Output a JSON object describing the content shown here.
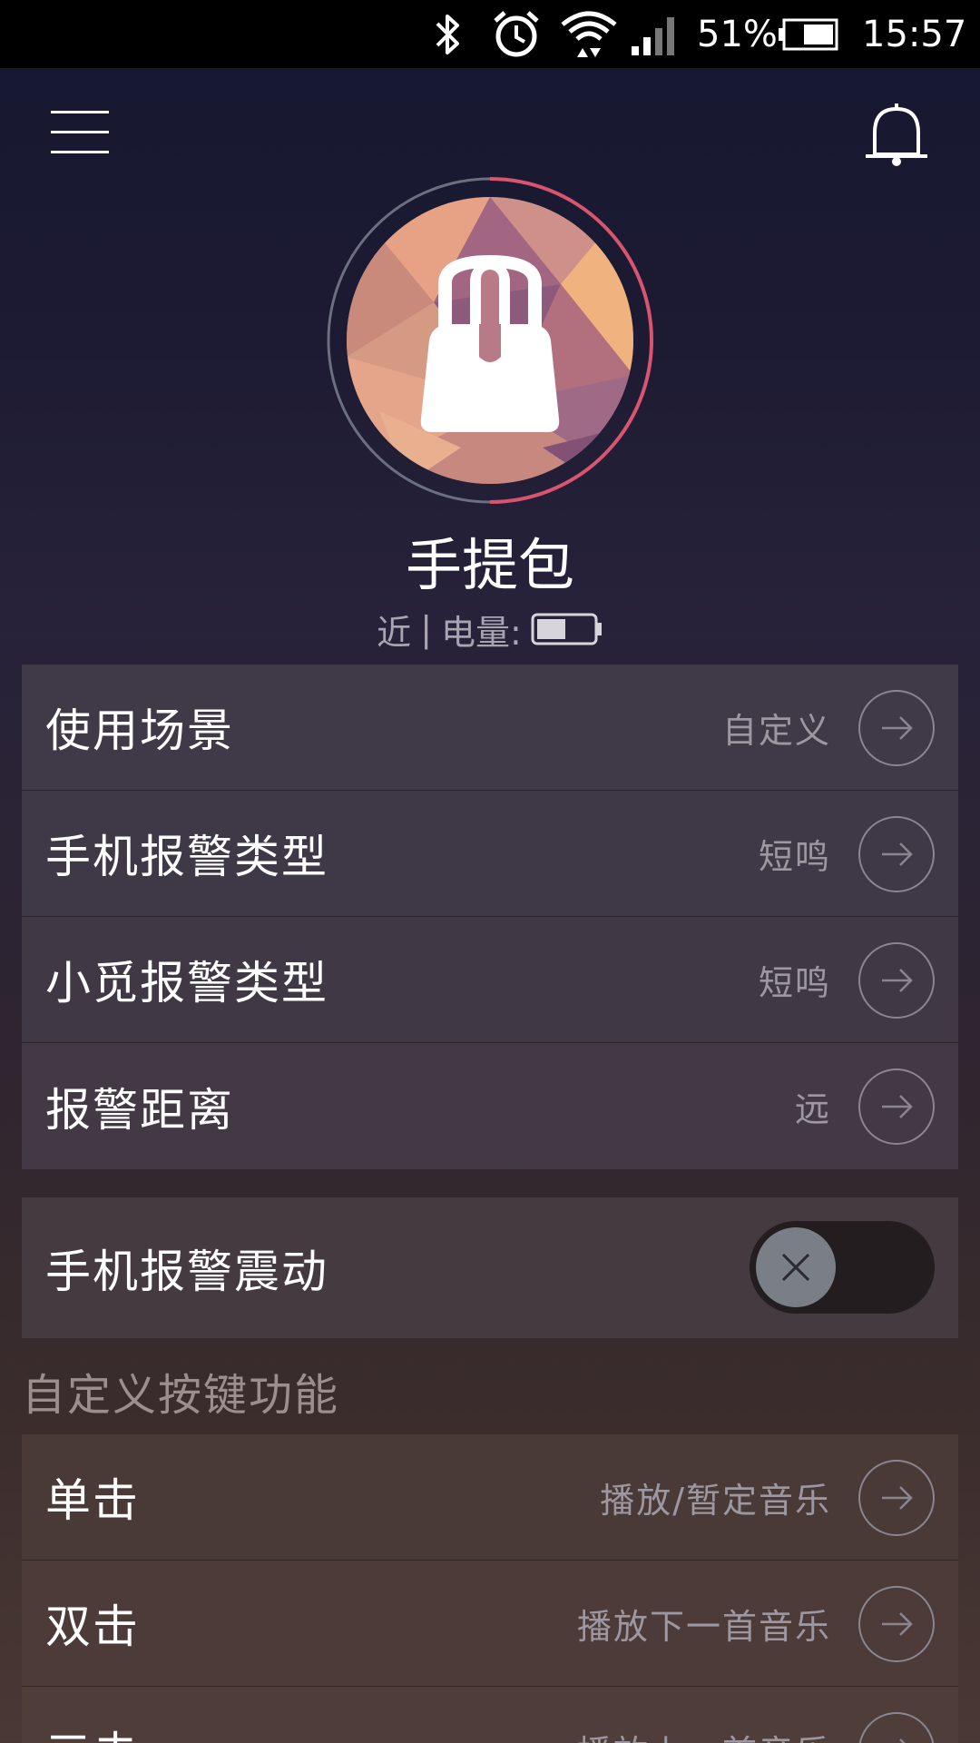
{
  "status_bar": {
    "battery_percent": "51%",
    "time": "15:57",
    "icons": [
      "bluetooth-icon",
      "alarm-icon",
      "wifi-icon",
      "signal-icon",
      "battery-icon"
    ]
  },
  "header": {
    "menu_icon": "menu-icon",
    "bell_icon": "bell-icon"
  },
  "device": {
    "name": "手提包",
    "distance": "近",
    "separator": "|",
    "battery_label": "电量:",
    "battery_level": 0.5,
    "icon": "handbag-icon"
  },
  "settings": [
    {
      "label": "使用场景",
      "value": "自定义"
    },
    {
      "label": "手机报警类型",
      "value": "短鸣"
    },
    {
      "label": "小觅报警类型",
      "value": "短鸣"
    },
    {
      "label": "报警距离",
      "value": "远"
    }
  ],
  "vibration": {
    "label": "手机报警震动",
    "enabled": false
  },
  "custom_keys": {
    "title": "自定义按键功能",
    "items": [
      {
        "label": "单击",
        "value": "播放/暂定音乐"
      },
      {
        "label": "双击",
        "value": "播放下一首音乐"
      },
      {
        "label": "三击",
        "value": "播放上一首音乐"
      }
    ]
  },
  "colors": {
    "accent_ring": "#d9556f",
    "background_top": "#151730",
    "background_bottom": "#4a3835"
  }
}
